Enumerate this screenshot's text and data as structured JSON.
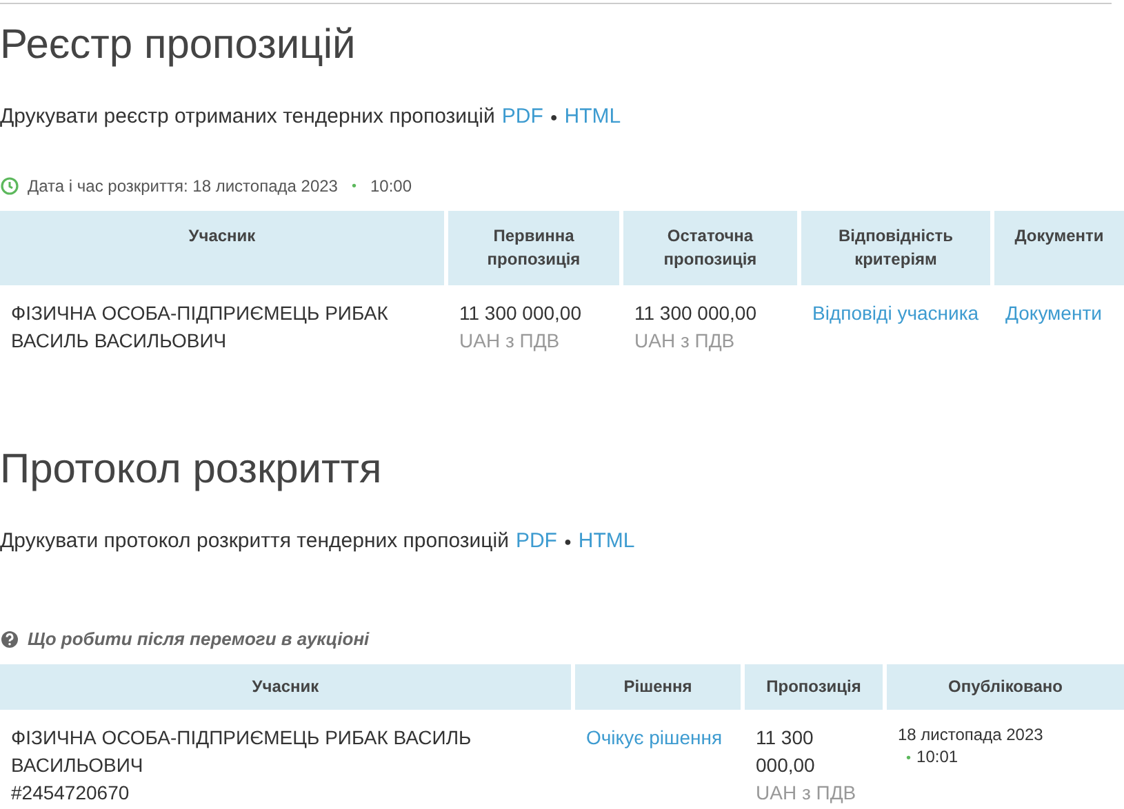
{
  "registry": {
    "title": "Реєстр пропозицій",
    "print": {
      "label": "Друкувати реєстр отриманих тендерних пропозицій",
      "links": [
        "PDF",
        "HTML"
      ],
      "separator": "●"
    },
    "note": {
      "kind": "clock",
      "text": "Дата і час розкриття: 18 листопада 2023",
      "separator": "•",
      "time": "10:00"
    },
    "table": {
      "columns": [
        "Учасник",
        "Первинна пропозиція",
        "Остаточна пропозиція",
        "Відповідність критеріям",
        "Документи"
      ],
      "rows": [
        {
          "cells": [
            {
              "kind": "text",
              "lines": [
                "ФІЗИЧНА ОСОБА-ПІДПРИЄМЕЦЬ РИБАК ВАСИЛЬ ВАСИЛЬОВИЧ"
              ]
            },
            {
              "kind": "amount",
              "value": "11 300 000,00",
              "currency": "UAH з ПДВ"
            },
            {
              "kind": "amount",
              "value": "11 300 000,00",
              "currency": "UAH з ПДВ"
            },
            {
              "kind": "link",
              "text": "Відповіді учасника"
            },
            {
              "kind": "link",
              "text": "Документи"
            }
          ]
        }
      ]
    }
  },
  "protocol": {
    "title": "Протокол розкриття",
    "print": {
      "label": "Друкувати протокол розкриття тендерних пропозицій",
      "links": [
        "PDF",
        "HTML"
      ],
      "separator": "●"
    },
    "note": {
      "kind": "help",
      "text": "Що робити після перемоги в аукціоні"
    },
    "table": {
      "columns": [
        "Учасник",
        "Рішення",
        "Пропозиція",
        "Опубліковано"
      ],
      "rows": [
        {
          "cells": [
            {
              "kind": "text",
              "lines": [
                "ФІЗИЧНА ОСОБА-ПІДПРИЄМЕЦЬ РИБАК ВАСИЛЬ ВАСИЛЬОВИЧ",
                "#2454720670"
              ]
            },
            {
              "kind": "link",
              "text": "Очікує рішення"
            },
            {
              "kind": "amount",
              "value": "11 300 000,00",
              "currency": "UAH з ПДВ"
            },
            {
              "kind": "datetime",
              "date": "18 листопада 2023",
              "separator": "•",
              "time": "10:01"
            }
          ]
        }
      ]
    }
  }
}
